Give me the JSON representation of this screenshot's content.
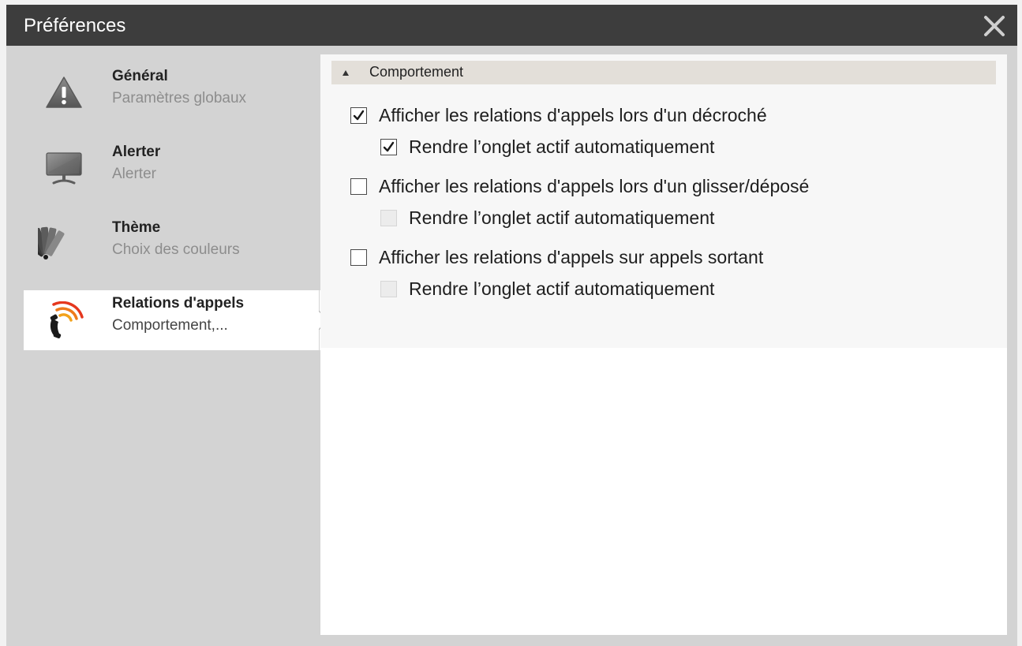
{
  "window": {
    "title": "Préférences",
    "close_icon": "close-icon"
  },
  "colors": {
    "titlebar": "#3d3d3d",
    "sidebar": "#d3d3d3",
    "section_header": "#e3dfd9",
    "accent": "#e85a1b"
  },
  "sidebar": {
    "items": [
      {
        "label": "Général",
        "sub": "Paramètres globaux",
        "icon": "warning-icon",
        "active": false
      },
      {
        "label": "Alerter",
        "sub": "Alerter",
        "icon": "monitor-icon",
        "active": false
      },
      {
        "label": "Thème",
        "sub": "Choix des couleurs",
        "icon": "color-swatch-icon",
        "active": false
      },
      {
        "label": "Relations d'appels",
        "sub": "Comportement,...",
        "icon": "phone-call-icon",
        "active": true
      }
    ]
  },
  "section": {
    "title": "Comportement",
    "options": [
      {
        "label": "Afficher les relations d'appels lors d'un décroché",
        "checked": true,
        "enabled": true
      },
      {
        "label": "Rendre l’onglet actif automatiquement",
        "checked": true,
        "enabled": true
      },
      {
        "label": "Afficher les relations d'appels lors d'un glisser/déposé",
        "checked": false,
        "enabled": true
      },
      {
        "label": "Rendre l’onglet actif automatiquement",
        "checked": false,
        "enabled": false
      },
      {
        "label": "Afficher les relations d'appels sur appels sortant",
        "checked": false,
        "enabled": true
      },
      {
        "label": "Rendre l’onglet actif automatiquement",
        "checked": false,
        "enabled": false
      }
    ]
  }
}
